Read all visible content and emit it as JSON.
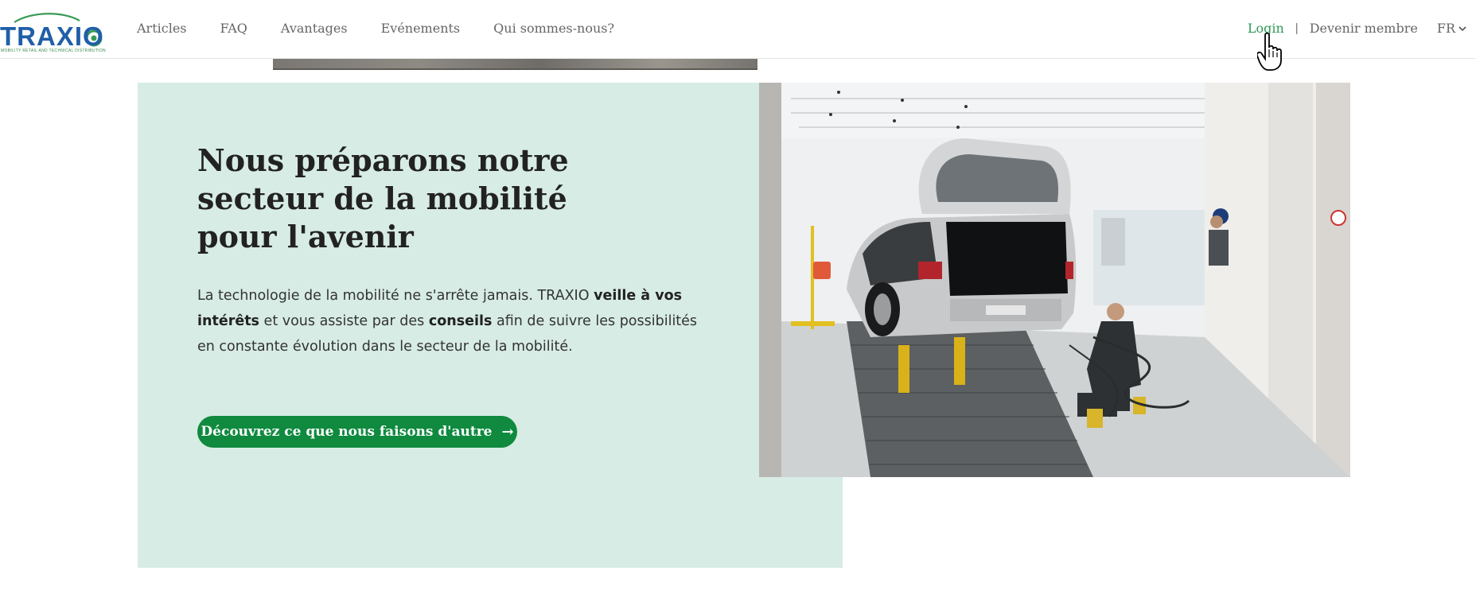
{
  "brand": {
    "logo_text": "TRAXIO",
    "logo_tagline": "MOBILITY RETAIL AND TECHNICAL DISTRIBUTION",
    "blue": "#1f5fa7",
    "green": "#2f9a57"
  },
  "nav": {
    "items": [
      "Articles",
      "FAQ",
      "Avantages",
      "Evénements",
      "Qui sommes-nous?"
    ]
  },
  "account": {
    "login_label": "Login",
    "separator": "|",
    "member_label": "Devenir membre",
    "language": "FR"
  },
  "hero": {
    "headline": "Nous préparons notre secteur de la mobilité pour l'avenir",
    "body_part1": "La technologie de la mobilité ne s'arrête jamais. TRAXIO ",
    "body_bold1": "veille à vos intérêts",
    "body_part2": " et vous assiste par des ",
    "body_bold2": "conseils",
    "body_part3": " afin de suivre les possibilités en constante évolution dans le secteur de la mobilité.",
    "cta_label": "Découvrez ce que nous faisons d'autre",
    "cta_icon": "arrow-right-icon",
    "panel_color": "#d7ece4",
    "cta_color": "#0f8a3f"
  },
  "photo": {
    "subject": "garage-spray-booth-car-photo"
  }
}
